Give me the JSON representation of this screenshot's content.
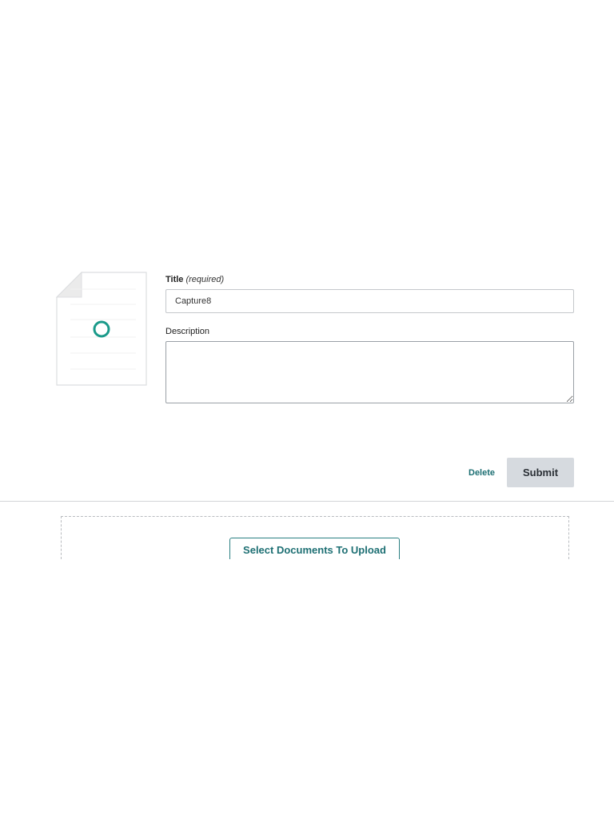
{
  "form": {
    "title_label": "Title",
    "title_required_note": "(required)",
    "title_value": "Capture8",
    "description_label": "Description",
    "description_value": ""
  },
  "thumbnail": {
    "icon": "document-icon",
    "spinner_icon": "loading-spinner-icon",
    "spinner_color": "#1a9a8a"
  },
  "actions": {
    "delete_label": "Delete",
    "submit_label": "Submit"
  },
  "upload": {
    "select_label": "Select Documents To Upload"
  },
  "colors": {
    "accent": "#1d6f73",
    "submit_bg": "#d6dadf",
    "border": "#c4c7cb"
  }
}
